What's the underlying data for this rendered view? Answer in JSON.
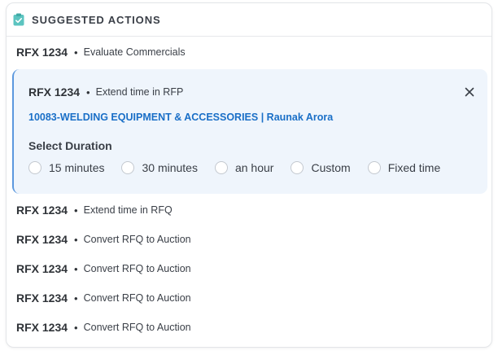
{
  "panel": {
    "title": "SUGGESTED ACTIONS",
    "icon": "clipboard-icon",
    "accent_color": "#5cc4c0"
  },
  "items": [
    {
      "rfx": "RFX 1234",
      "separator": "•",
      "action": "Evaluate Commercials"
    }
  ],
  "expanded": {
    "rfx": "RFX 1234",
    "separator": "•",
    "action": "Extend time in RFP",
    "link": "10083-WELDING EQUIPMENT & ACCESSORIES | Raunak Arora",
    "link_color": "#1a6fc7",
    "close_icon": "close-icon",
    "duration_label": "Select Duration",
    "options": [
      "15 minutes",
      "30 minutes",
      "an hour",
      "Custom",
      "Fixed time"
    ]
  },
  "rest_items": [
    {
      "rfx": "RFX 1234",
      "separator": "•",
      "action": "Extend time in RFQ"
    },
    {
      "rfx": "RFX 1234",
      "separator": "•",
      "action": "Convert RFQ to Auction"
    },
    {
      "rfx": "RFX 1234",
      "separator": "•",
      "action": "Convert RFQ to Auction"
    },
    {
      "rfx": "RFX 1234",
      "separator": "•",
      "action": "Convert RFQ to Auction"
    },
    {
      "rfx": "RFX 1234",
      "separator": "•",
      "action": "Convert RFQ to Auction"
    }
  ]
}
